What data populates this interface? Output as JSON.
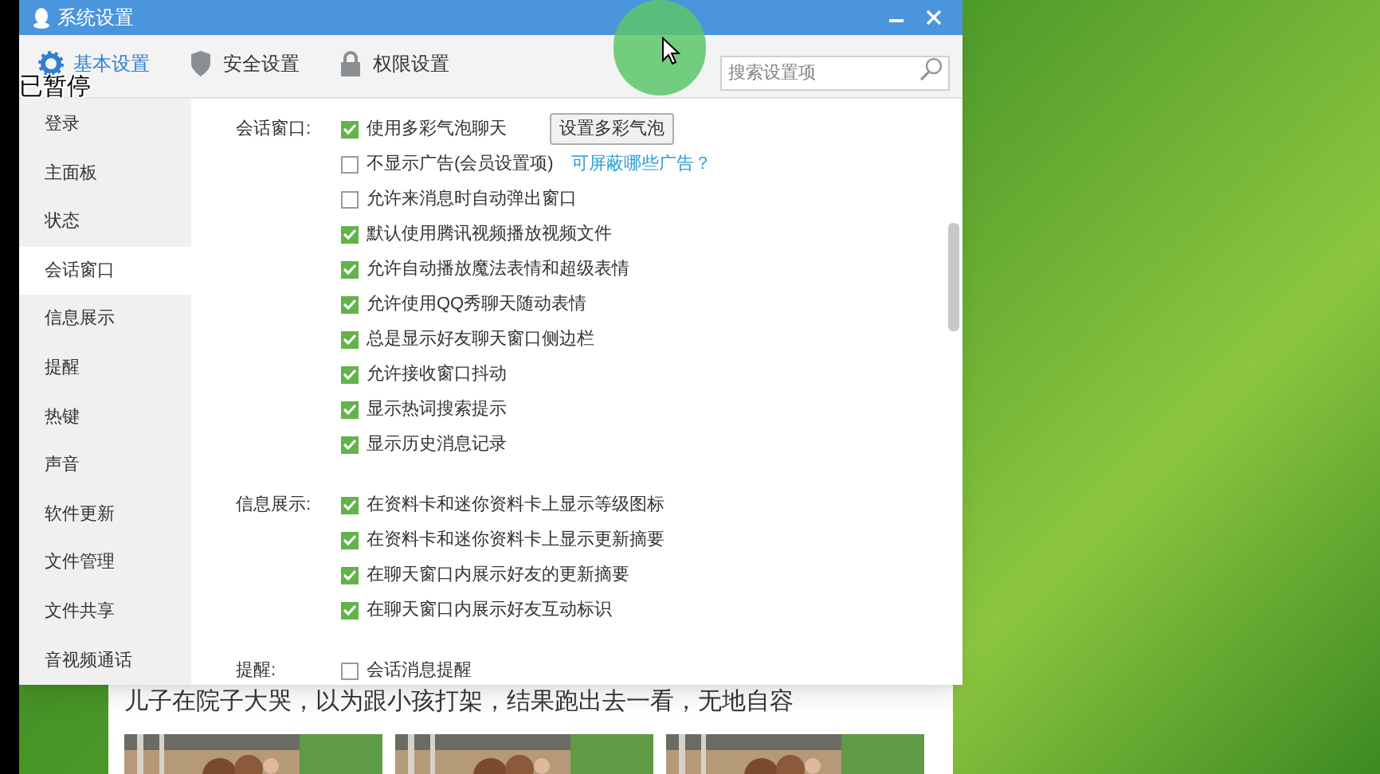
{
  "overlay_text": "已暂停",
  "window": {
    "title": "系统设置",
    "tabs": [
      {
        "label": "基本设置",
        "selected": true
      },
      {
        "label": "安全设置",
        "selected": false
      },
      {
        "label": "权限设置",
        "selected": false
      }
    ],
    "search": {
      "placeholder": "搜索设置项"
    },
    "sidebar": {
      "items": [
        {
          "label": "登录",
          "selected": false
        },
        {
          "label": "主面板",
          "selected": false
        },
        {
          "label": "状态",
          "selected": false
        },
        {
          "label": "会话窗口",
          "selected": true
        },
        {
          "label": "信息展示",
          "selected": false
        },
        {
          "label": "提醒",
          "selected": false
        },
        {
          "label": "热键",
          "selected": false
        },
        {
          "label": "声音",
          "selected": false
        },
        {
          "label": "软件更新",
          "selected": false
        },
        {
          "label": "文件管理",
          "selected": false
        },
        {
          "label": "文件共享",
          "selected": false
        },
        {
          "label": "音视频通话",
          "selected": false
        }
      ]
    },
    "sections": [
      {
        "label": "会话窗口:",
        "options": [
          {
            "label": "使用多彩气泡聊天",
            "checked": true,
            "button": "设置多彩气泡"
          },
          {
            "label": "不显示广告(会员设置项)",
            "checked": false,
            "link": "可屏蔽哪些广告？"
          },
          {
            "label": "允许来消息时自动弹出窗口",
            "checked": false
          },
          {
            "label": "默认使用腾讯视频播放视频文件",
            "checked": true
          },
          {
            "label": "允许自动播放魔法表情和超级表情",
            "checked": true
          },
          {
            "label": "允许使用QQ秀聊天随动表情",
            "checked": true
          },
          {
            "label": "总是显示好友聊天窗口侧边栏",
            "checked": true
          },
          {
            "label": "允许接收窗口抖动",
            "checked": true
          },
          {
            "label": "显示热词搜索提示",
            "checked": true
          },
          {
            "label": "显示历史消息记录",
            "checked": true
          }
        ]
      },
      {
        "label": "信息展示:",
        "options": [
          {
            "label": "在资料卡和迷你资料卡上显示等级图标",
            "checked": true
          },
          {
            "label": "在资料卡和迷你资料卡上显示更新摘要",
            "checked": true
          },
          {
            "label": "在聊天窗口内展示好友的更新摘要",
            "checked": true
          },
          {
            "label": "在聊天窗口内展示好友互动标识",
            "checked": true
          }
        ]
      },
      {
        "label": "提醒:",
        "options": [
          {
            "label": "会话消息提醒",
            "checked": false
          }
        ]
      }
    ]
  },
  "news_card": {
    "headline": "儿子在院子大哭，以为跟小孩打架，结果跑出去一看，无地自容"
  }
}
